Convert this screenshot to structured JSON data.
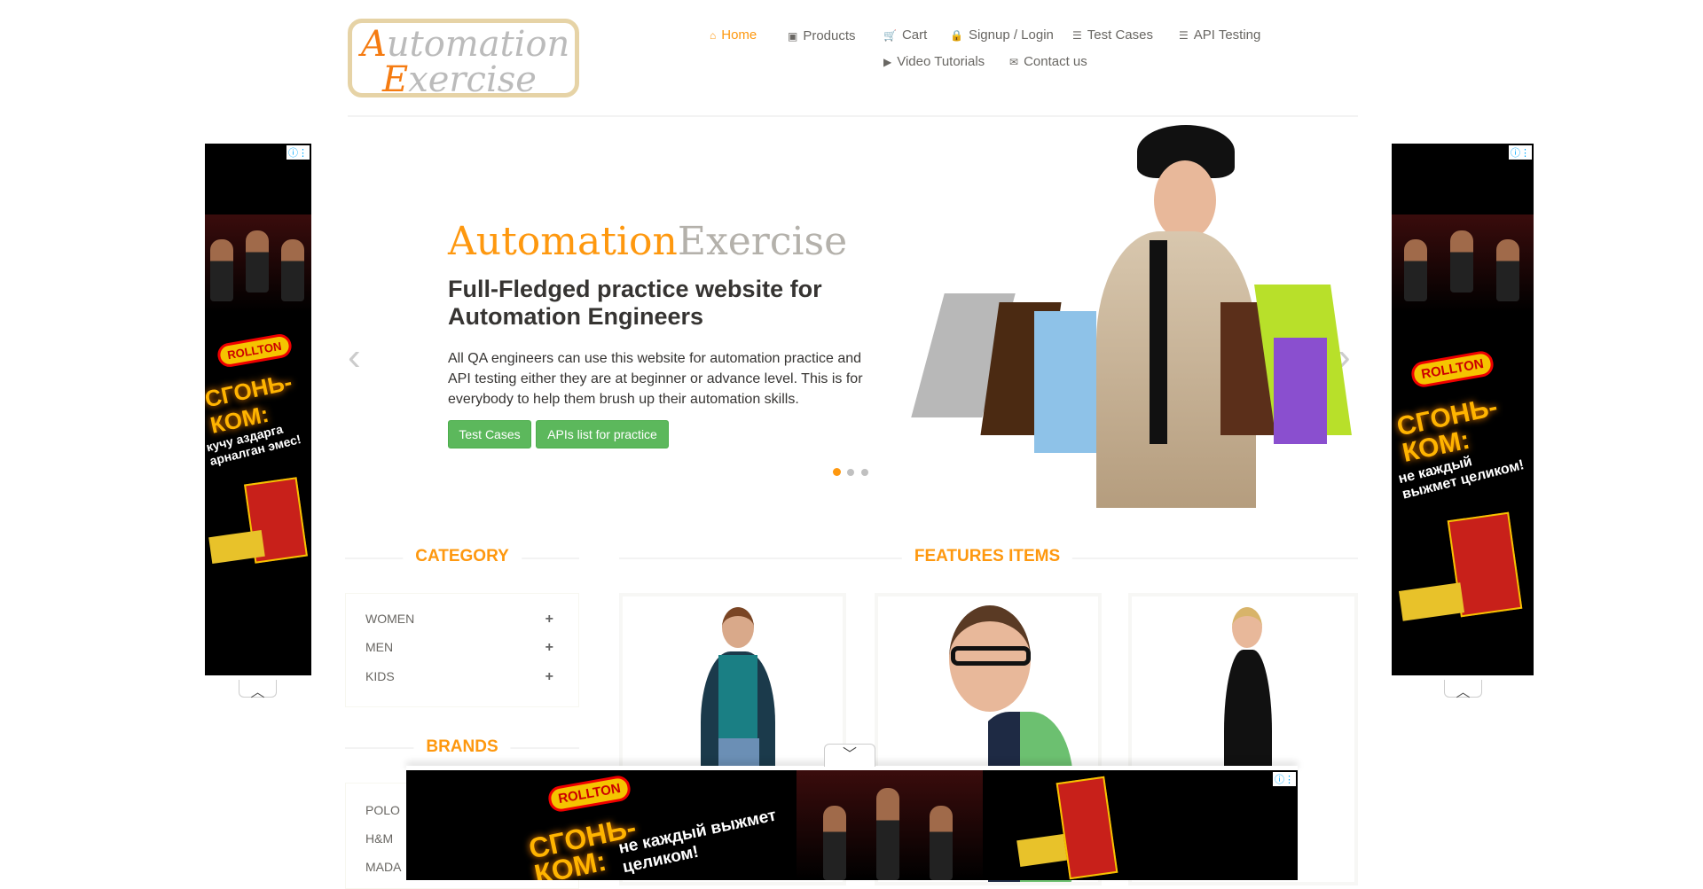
{
  "logo": {
    "line1_first": "A",
    "line1_rest": "utomation",
    "line2_first": "E",
    "line2_rest": "xercise"
  },
  "nav": [
    {
      "label": "Home",
      "icon": "home-icon",
      "glyph": "⌂"
    },
    {
      "label": "Products",
      "icon": "products-icon",
      "glyph": "▣"
    },
    {
      "label": "Cart",
      "icon": "cart-icon",
      "glyph": "🛒"
    },
    {
      "label": "Signup / Login",
      "icon": "lock-icon",
      "glyph": "🔒"
    },
    {
      "label": "Test Cases",
      "icon": "list-icon",
      "glyph": "☰"
    },
    {
      "label": "API Testing",
      "icon": "list-icon",
      "glyph": "☰"
    },
    {
      "label": "Video Tutorials",
      "icon": "youtube-icon",
      "glyph": "▶"
    },
    {
      "label": "Contact us",
      "icon": "envelope-icon",
      "glyph": "✉"
    }
  ],
  "hero": {
    "brand_a": "Automation",
    "brand_b": "Exercise",
    "heading": "Full-Fledged practice website for Automation Engineers",
    "text": "All QA engineers can use this website for automation practice and API testing either they are at beginner or advance level. This is for everybody to help them brush up their automation skills.",
    "btn_test_cases": "Test Cases",
    "btn_apis": "APIs list for practice",
    "active_slide": 1,
    "slide_count": 3,
    "accent": "#fe980f",
    "button_color": "#5cb85c"
  },
  "category": {
    "title": "CATEGORY",
    "items": [
      "WOMEN",
      "MEN",
      "KIDS"
    ]
  },
  "brands": {
    "title": "BRANDS",
    "items": [
      "POLO",
      "H&M",
      "MADA"
    ]
  },
  "features": {
    "title": "FEATURES ITEMS"
  },
  "ads": {
    "brand": "ROLLTON",
    "product": "СГОНЬ-КОМ:",
    "left_tagline": "кучу аздарга арналган эмес!",
    "tagline": "не каждый выжмет целиком!",
    "info": "ⓘ⋮"
  }
}
